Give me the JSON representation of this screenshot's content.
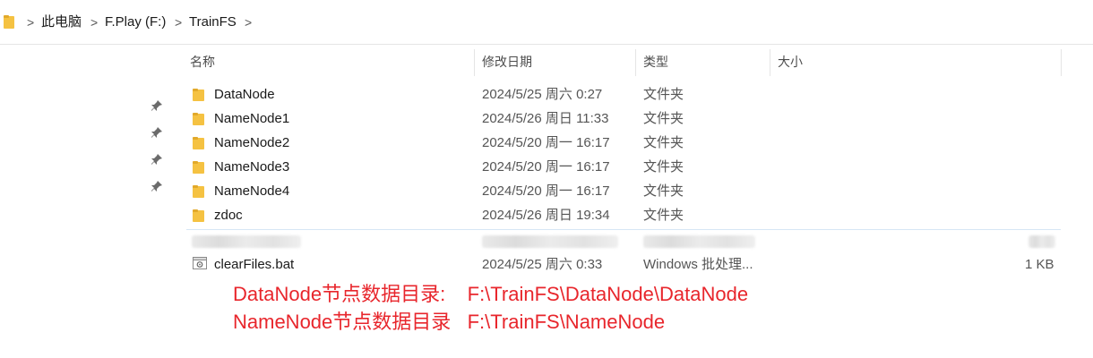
{
  "breadcrumb": {
    "items": [
      "此电脑",
      "F.Play (F:)",
      "TrainFS"
    ],
    "separator": ">"
  },
  "columns": {
    "name": "名称",
    "modified": "修改日期",
    "type": "类型",
    "size": "大小"
  },
  "files": [
    {
      "name": "DataNode",
      "modified": "2024/5/25 周六 0:27",
      "type": "文件夹",
      "size": "",
      "icon": "folder-icon"
    },
    {
      "name": "NameNode1",
      "modified": "2024/5/26 周日 11:33",
      "type": "文件夹",
      "size": "",
      "icon": "folder-icon"
    },
    {
      "name": "NameNode2",
      "modified": "2024/5/20 周一 16:17",
      "type": "文件夹",
      "size": "",
      "icon": "folder-icon"
    },
    {
      "name": "NameNode3",
      "modified": "2024/5/20 周一 16:17",
      "type": "文件夹",
      "size": "",
      "icon": "folder-icon"
    },
    {
      "name": "NameNode4",
      "modified": "2024/5/20 周一 16:17",
      "type": "文件夹",
      "size": "",
      "icon": "folder-icon"
    },
    {
      "name": "zdoc",
      "modified": "2024/5/26 周日 19:34",
      "type": "文件夹",
      "size": "",
      "icon": "folder-icon"
    }
  ],
  "bat_file": {
    "name": "clearFiles.bat",
    "modified": "2024/5/25 周六 0:33",
    "type": "Windows 批处理...",
    "size": "1 KB",
    "icon": "batch-file-icon"
  },
  "annotations": {
    "line1": "DataNode节点数据目录:    F:\\TrainFS\\DataNode\\DataNode",
    "line2": "NameNode节点数据目录   F:\\TrainFS\\NameNode"
  },
  "colors": {
    "annotation": "#e8262c",
    "folder": "#f5c242",
    "pin": "#6b6b6b"
  }
}
